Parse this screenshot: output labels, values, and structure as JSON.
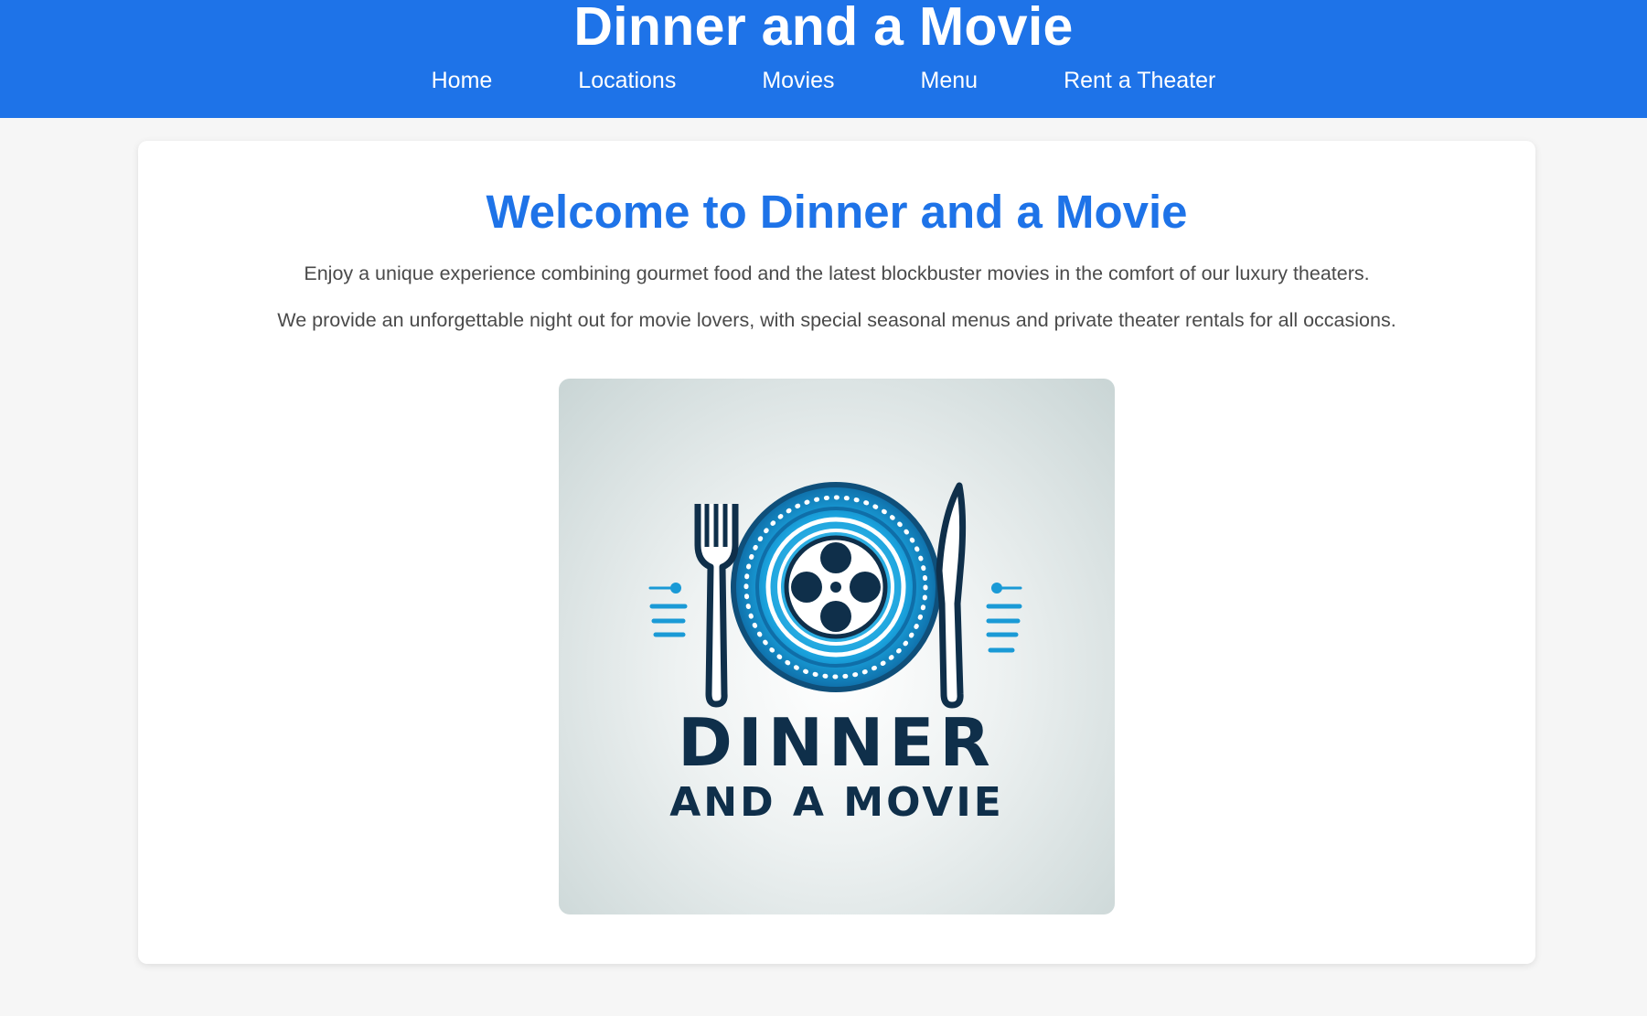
{
  "header": {
    "title": "Dinner and a Movie",
    "nav": [
      "Home",
      "Locations",
      "Movies",
      "Menu",
      "Rent a Theater"
    ]
  },
  "main": {
    "heading": "Welcome to Dinner and a Movie",
    "paragraphs": [
      "Enjoy a unique experience combining gourmet food and the latest blockbuster movies in the comfort of our luxury theaters.",
      "We provide an unforgettable night out for movie lovers, with special seasonal menus and private theater rentals for all occasions."
    ],
    "logo": {
      "line1": "DINNER",
      "line2": "AND A MOVIE"
    }
  },
  "colors": {
    "brand": "#1e73e8",
    "text": "#4a4a4a",
    "background": "#f6f6f6",
    "logo_dark": "#0f2f4a",
    "logo_blue": "#1a9ad6"
  },
  "icons": [
    "fork-icon",
    "knife-icon",
    "plate-icon",
    "film-reel-icon"
  ]
}
